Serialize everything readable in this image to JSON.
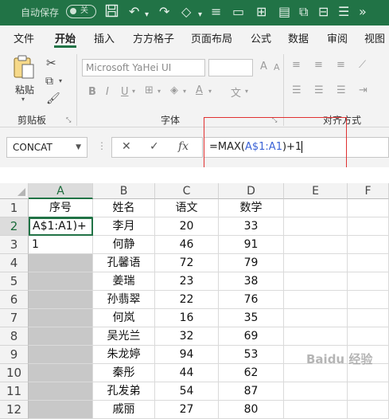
{
  "titlebar": {
    "autosave": "自动保存",
    "toggle": "关"
  },
  "tabs": [
    {
      "label": "文件"
    },
    {
      "label": "开始"
    },
    {
      "label": "插入"
    },
    {
      "label": "方方格子"
    },
    {
      "label": "页面布局"
    },
    {
      "label": "公式"
    },
    {
      "label": "数据"
    },
    {
      "label": "审阅"
    },
    {
      "label": "视图"
    }
  ],
  "ribbon": {
    "paste_label": "粘贴",
    "clipboard_label": "剪贴板",
    "font_name": "Microsoft YaHei UI",
    "font_group_label": "字体",
    "align_group_label": "对齐方式",
    "bold": "B",
    "italic": "I",
    "underline": "U",
    "font_size_up": "A",
    "font_size_down": "A"
  },
  "formula_bar": {
    "name_box": "CONCAT",
    "cancel": "✕",
    "enter": "✓",
    "fx": "fx",
    "formula_prefix": "=MAX(",
    "formula_ref": "A$1:A1",
    "formula_suffix": ")+1"
  },
  "grid": {
    "columns": [
      "A",
      "B",
      "C",
      "D",
      "E",
      "F"
    ],
    "rows": [
      {
        "n": "1",
        "a": "序号",
        "b": "姓名",
        "c": "语文",
        "d": "数学"
      },
      {
        "n": "2",
        "a": "A$1:A1)+",
        "b": "李月",
        "c": "20",
        "d": "33"
      },
      {
        "n": "3",
        "a": "1",
        "b": "何静",
        "c": "46",
        "d": "91"
      },
      {
        "n": "4",
        "a": "",
        "b": "孔馨语",
        "c": "72",
        "d": "79"
      },
      {
        "n": "5",
        "a": "",
        "b": "姜瑞",
        "c": "23",
        "d": "38"
      },
      {
        "n": "6",
        "a": "",
        "b": "孙翡翠",
        "c": "22",
        "d": "76"
      },
      {
        "n": "7",
        "a": "",
        "b": "何岚",
        "c": "16",
        "d": "35"
      },
      {
        "n": "8",
        "a": "",
        "b": "吴光兰",
        "c": "32",
        "d": "69"
      },
      {
        "n": "9",
        "a": "",
        "b": "朱龙婷",
        "c": "94",
        "d": "53"
      },
      {
        "n": "10",
        "a": "",
        "b": "秦彤",
        "c": "44",
        "d": "62"
      },
      {
        "n": "11",
        "a": "",
        "b": "孔发弟",
        "c": "54",
        "d": "87"
      },
      {
        "n": "12",
        "a": "",
        "b": "戚丽",
        "c": "27",
        "d": "80"
      }
    ]
  },
  "watermark": "Baidu 经验"
}
